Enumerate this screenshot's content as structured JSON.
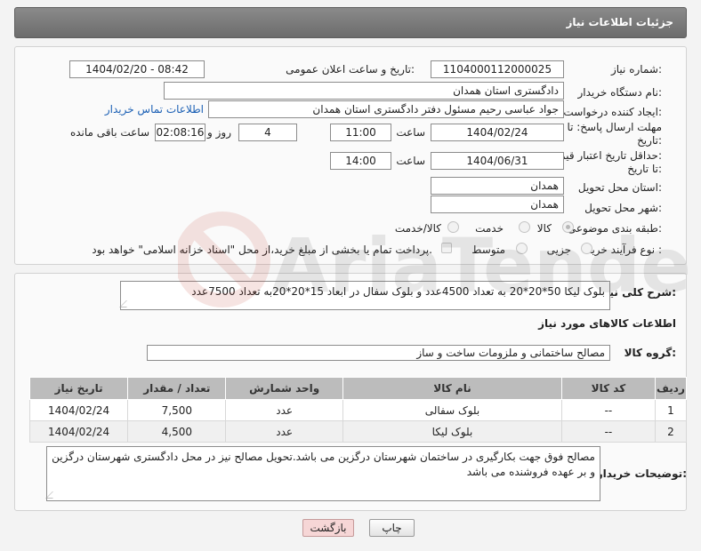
{
  "header": {
    "title": "جزئیات اطلاعات نیاز"
  },
  "fields": {
    "need_number_label": "شماره نیاز:",
    "need_number": "1104000112000025",
    "announce_label": "تاریخ و ساعت اعلان عمومی:",
    "announce_value": "1404/02/20 - 08:42",
    "buyer_org_label": "نام دستگاه خریدار:",
    "buyer_org": "دادگستری استان همدان",
    "requester_label": "ایجاد کننده درخواست:",
    "requester": "جواد عباسی رحیم مسئول دفتر دادگستری استان همدان",
    "contact_link": "اطلاعات تماس خریدار",
    "deadline_label_1": "مهلت ارسال پاسخ: تا",
    "deadline_label_2": "تاریخ:",
    "deadline_date": "1404/02/24",
    "time_label": "ساعت",
    "deadline_time": "11:00",
    "days_value": "4",
    "days_label": "روز و",
    "remaining_value": "02:08:16",
    "remaining_label": "ساعت باقی مانده",
    "validity_label_1": "حداقل تاریخ اعتبار قیمت:",
    "validity_label_2": "تا تاریخ:",
    "validity_date": "1404/06/31",
    "validity_time": "14:00",
    "province_label": "استان محل تحویل:",
    "province": "همدان",
    "city_label": "شهر محل تحویل:",
    "city": "همدان",
    "category_label": "طبقه بندی موضوعی:",
    "category_options": [
      "کالا",
      "خدمت",
      "کالا/خدمت"
    ],
    "process_label": "نوع فرآیند خرید :",
    "process_options": [
      "جزیی",
      "متوسط"
    ],
    "payment_note": "پرداخت تمام یا بخشی از مبلغ خرید،از محل \"اسناد خزانه اسلامی\" خواهد بود."
  },
  "description": {
    "label": "شرح کلی نیاز:",
    "text": "بلوک لیکا 50*20*20 به تعداد 4500عدد و بلوک سفال در ابعاد 15*20*20به تعداد 7500عدد"
  },
  "goods_section": {
    "title": "اطلاعات کالاهای مورد نیاز",
    "group_label": "گروه کالا:",
    "group_value": "مصالح ساختمانی و ملزومات ساخت و ساز"
  },
  "table": {
    "headers": [
      "ردیف",
      "کد کالا",
      "نام کالا",
      "واحد شمارش",
      "تعداد / مقدار",
      "تاریخ نیاز"
    ],
    "rows": [
      [
        "1",
        "--",
        "بلوک سفالی",
        "عدد",
        "7,500",
        "1404/02/24"
      ],
      [
        "2",
        "--",
        "بلوک لیکا",
        "عدد",
        "4,500",
        "1404/02/24"
      ]
    ]
  },
  "buyer_notes": {
    "label": "توضیحات خریدار:",
    "text": "مصالح فوق جهت بکارگیری در ساختمان شهرستان درگزین می باشد.تحویل مصالح نیز  در محل دادگستری شهرستان درگزین و بر عهده فروشنده می باشد"
  },
  "buttons": {
    "print": "چاپ",
    "back": "بازگشت"
  },
  "colors": {
    "header_bg": "#7a7a7a",
    "link": "#1a5fb4",
    "back_button": "#f6d6d6"
  },
  "watermark": {
    "text": "AriaTender.neT"
  }
}
